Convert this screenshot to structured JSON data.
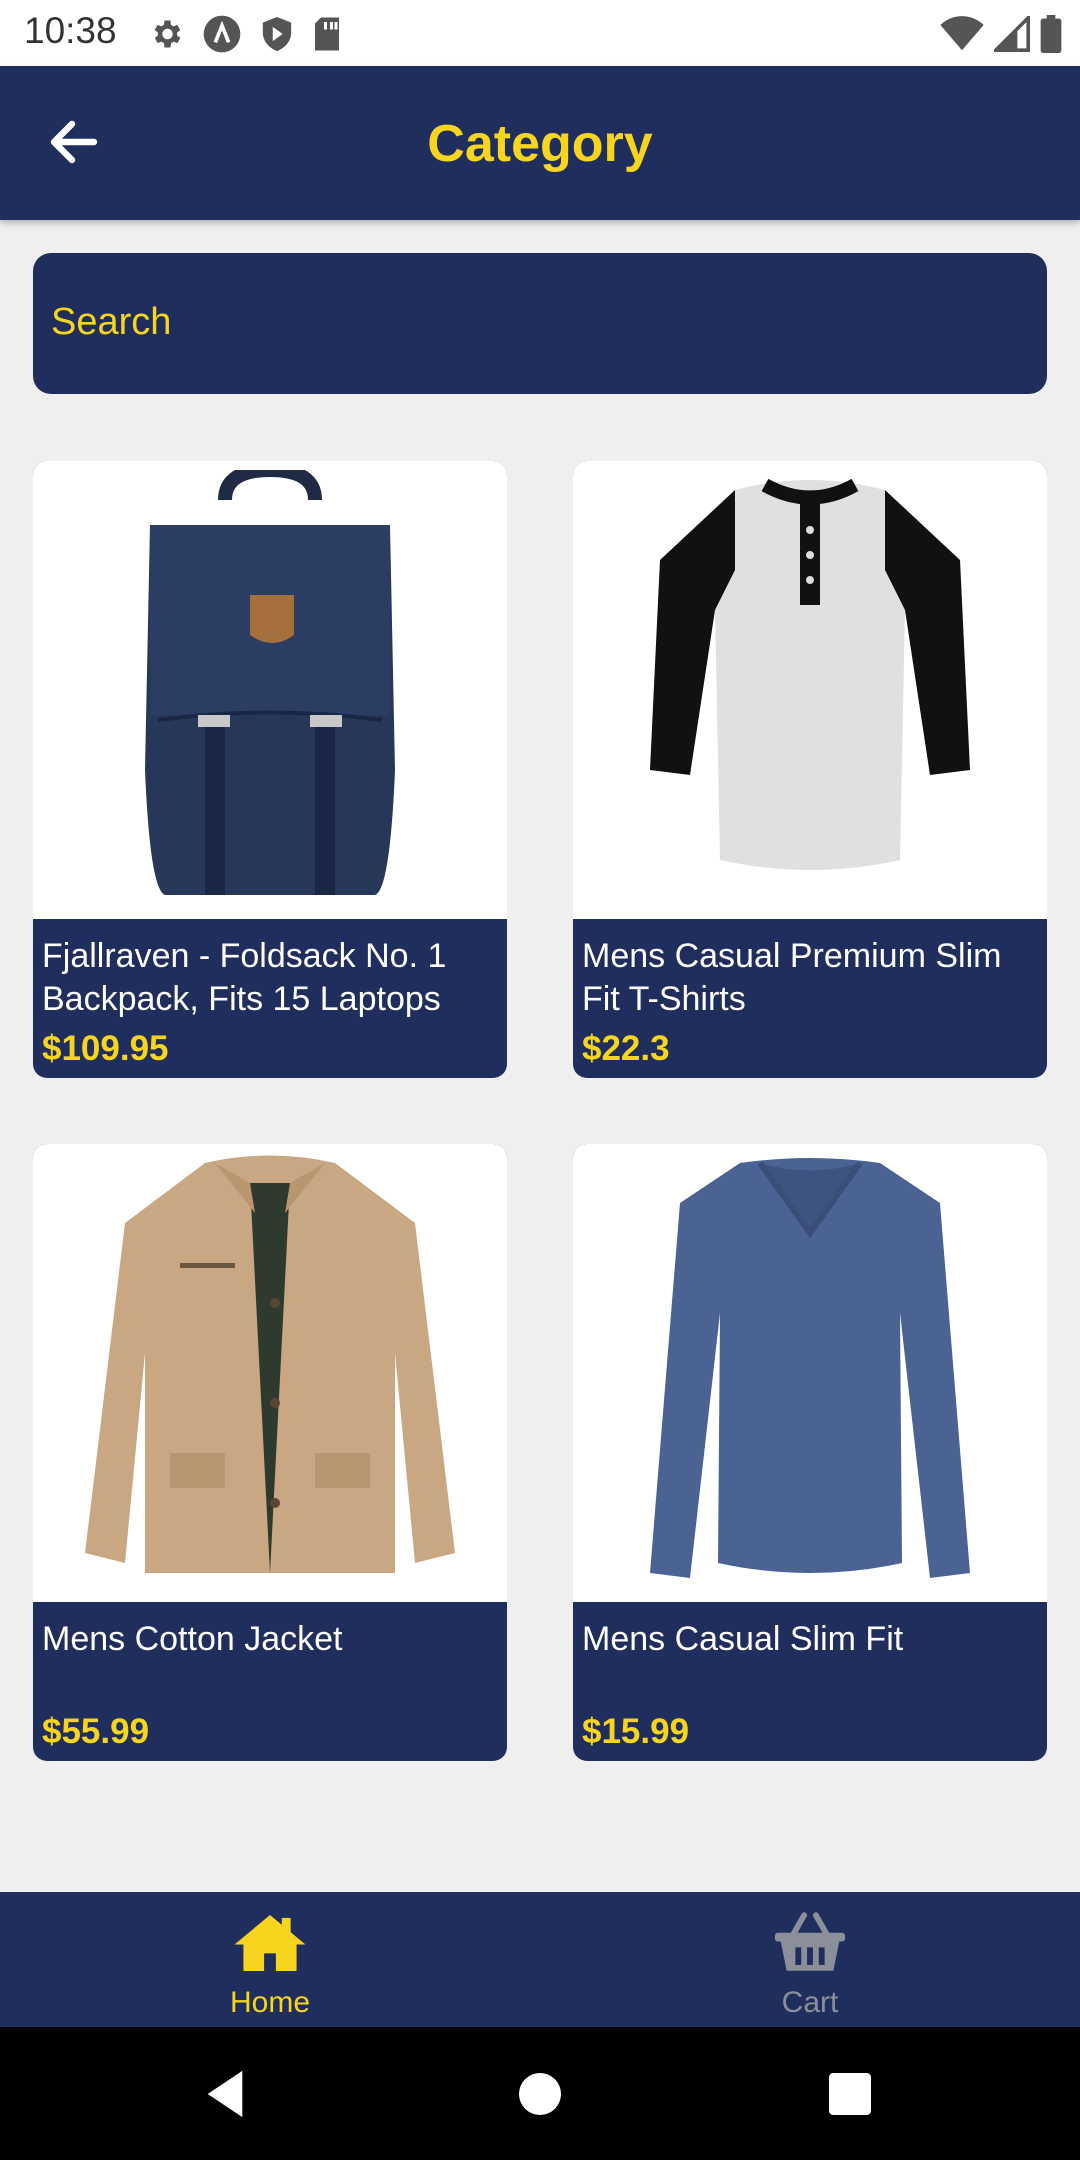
{
  "status_bar": {
    "time": "10:38",
    "icons_left": [
      "gear-icon",
      "a-icon",
      "shield-play-icon",
      "sd-card-icon"
    ],
    "icons_right": [
      "wifi-icon",
      "signal-icon",
      "battery-icon"
    ]
  },
  "header": {
    "back_icon": "arrow-left-icon",
    "title": "Category"
  },
  "search": {
    "placeholder": "Search"
  },
  "products": [
    {
      "title": "Fjallraven - Foldsack No. 1 Backpack, Fits 15 Laptops",
      "price": "$109.95",
      "image": "backpack"
    },
    {
      "title": "Mens Casual Premium Slim Fit T-Shirts",
      "price": "$22.3",
      "image": "raglan-tshirt"
    },
    {
      "title": "Mens Cotton Jacket",
      "price": "$55.99",
      "image": "cotton-jacket"
    },
    {
      "title": "Mens Casual Slim Fit",
      "price": "$15.99",
      "image": "long-sleeve-shirt"
    }
  ],
  "bottom_nav": {
    "items": [
      {
        "label": "Home",
        "icon": "home-icon",
        "active": true
      },
      {
        "label": "Cart",
        "icon": "basket-icon",
        "active": false
      }
    ]
  },
  "colors": {
    "primary": "#1f2e5c",
    "accent": "#f7d51e",
    "background": "#efeff0",
    "inactive": "#8a8f9a"
  }
}
